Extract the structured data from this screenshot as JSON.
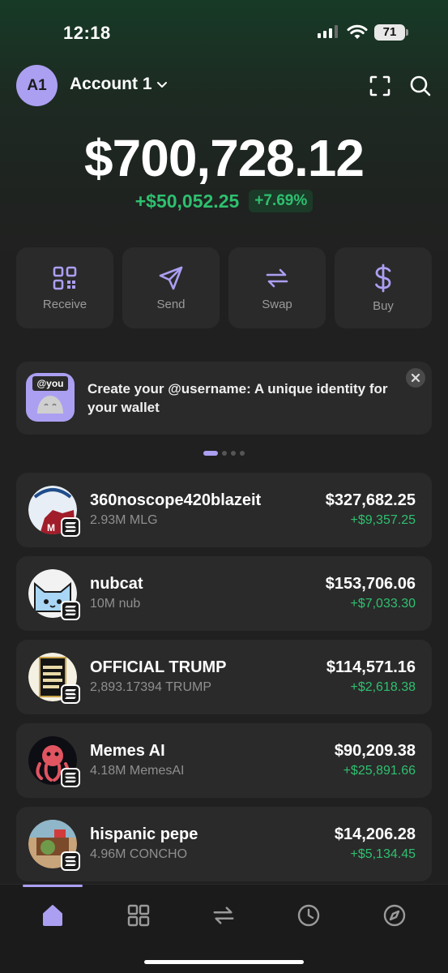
{
  "status_bar": {
    "time": "12:18",
    "battery": "71"
  },
  "header": {
    "avatar": "A1",
    "account_name": "Account 1"
  },
  "portfolio": {
    "balance": "$700,728.12",
    "change_amount": "+$50,052.25",
    "change_percent": "+7.69%"
  },
  "actions": [
    {
      "label": "Receive",
      "icon": "qr-code-icon"
    },
    {
      "label": "Send",
      "icon": "send-icon"
    },
    {
      "label": "Swap",
      "icon": "swap-icon"
    },
    {
      "label": "Buy",
      "icon": "dollar-icon"
    }
  ],
  "banner": {
    "badge": "@you",
    "text": "Create your @username: A unique identity for your wallet"
  },
  "tokens": [
    {
      "name": "360noscope420blazeit",
      "quantity": "2.93M MLG",
      "value": "$327,682.25",
      "change": "+$9,357.25"
    },
    {
      "name": "nubcat",
      "quantity": "10M nub",
      "value": "$153,706.06",
      "change": "+$7,033.30"
    },
    {
      "name": "OFFICIAL TRUMP",
      "quantity": "2,893.17394 TRUMP",
      "value": "$114,571.16",
      "change": "+$2,618.38"
    },
    {
      "name": "Memes AI",
      "quantity": "4.18M MemesAI",
      "value": "$90,209.38",
      "change": "+$25,891.66"
    },
    {
      "name": "hispanic pepe",
      "quantity": "4.96M CONCHO",
      "value": "$14,206.28",
      "change": "+$5,134.45"
    }
  ],
  "tabs": [
    "home-icon",
    "collectibles-icon",
    "swap-icon",
    "history-icon",
    "explore-icon"
  ],
  "colors": {
    "accent": "#ab9ff2",
    "positive": "#2ec06f",
    "card": "#2a2a2a"
  }
}
